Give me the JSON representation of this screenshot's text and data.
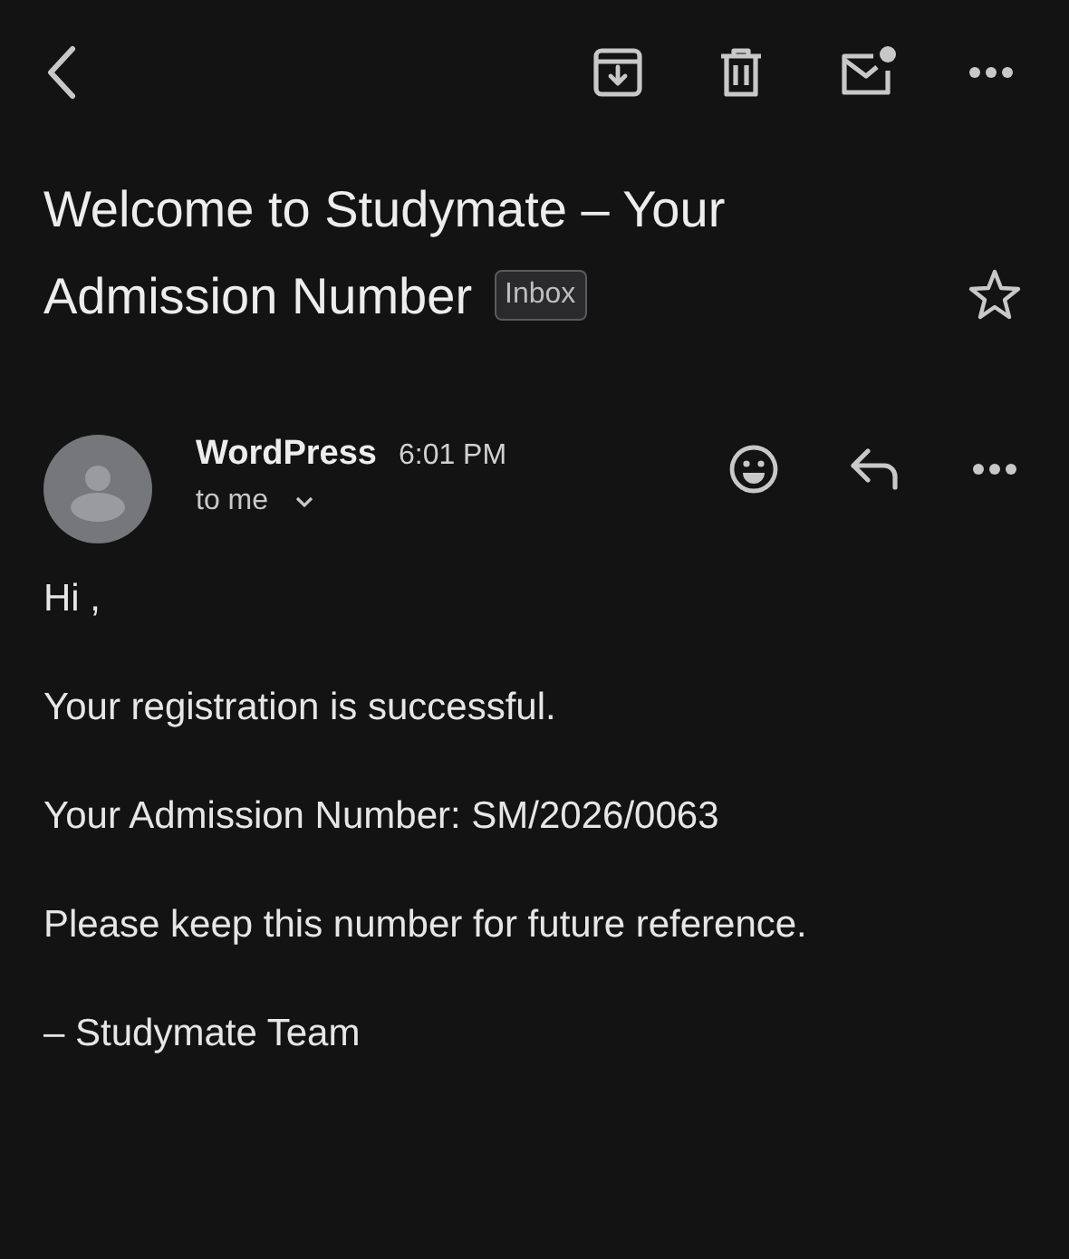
{
  "subject": {
    "title": "Welcome to Studymate – Your Admission Number",
    "label": "Inbox",
    "starred": false
  },
  "message": {
    "sender": "WordPress",
    "time": "6:01 PM",
    "recipient": "to me"
  },
  "body": [
    "Hi ,",
    "Your registration is successful.",
    "Your Admission Number: SM/2026/0063",
    "Please keep this number for future reference.",
    "– Studymate Team"
  ]
}
